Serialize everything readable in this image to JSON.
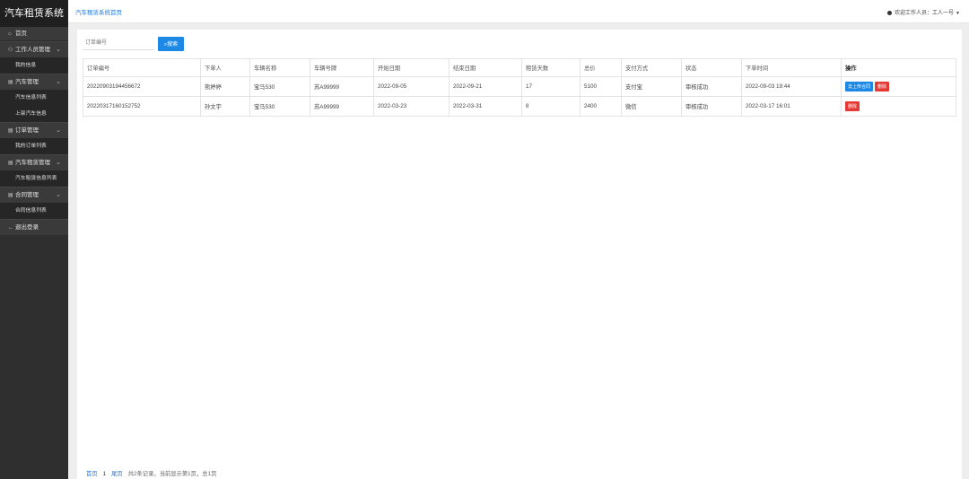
{
  "app": {
    "title": "汽车租赁系统"
  },
  "sidebar": {
    "home": "首页",
    "groups": [
      {
        "label": "工作人员管理",
        "sub": [
          "我的信息"
        ]
      },
      {
        "label": "汽车管理",
        "sub": [
          "汽车信息列表",
          "上架汽车信息"
        ]
      },
      {
        "label": "订单管理",
        "sub": [
          "我的订单列表"
        ]
      },
      {
        "label": "汽车租赁管理",
        "sub": [
          "汽车租赁信息列表"
        ]
      },
      {
        "label": "合同管理",
        "sub": [
          "合同信息列表"
        ]
      }
    ],
    "logout": "退出登录"
  },
  "header": {
    "breadcrumb": "汽车租赁系统首页",
    "user": "欢迎工作人员：工人一号"
  },
  "search": {
    "placeholder": "订单编号",
    "button": "搜索"
  },
  "table": {
    "columns": [
      "订单编号",
      "下单人",
      "车辆名称",
      "车辆号牌",
      "开始日期",
      "结束日期",
      "租赁天数",
      "总价",
      "支付方式",
      "状态",
      "下单时间",
      "操作"
    ],
    "rows": [
      {
        "cells": [
          "20220903194456672",
          "熊婷婷",
          "宝马530",
          "苏A99999",
          "2022-09-05",
          "2022-09-21",
          "17",
          "5100",
          "支付宝",
          "审核成功",
          "2022-09-03 19:44"
        ],
        "actions": [
          {
            "label": "去上传合同",
            "kind": "primary"
          },
          {
            "label": "删除",
            "kind": "danger"
          }
        ]
      },
      {
        "cells": [
          "20220317160152752",
          "孙文宇",
          "宝马530",
          "苏A99999",
          "2022-03-23",
          "2022-03-31",
          "8",
          "2400",
          "微信",
          "审核成功",
          "2022-03-17 16:01"
        ],
        "actions": [
          {
            "label": "删除",
            "kind": "danger"
          }
        ]
      }
    ]
  },
  "pager": {
    "first": "首页",
    "current": "1",
    "last": "尾页",
    "summary": "共2条记录，当前显示第1页，总1页"
  }
}
